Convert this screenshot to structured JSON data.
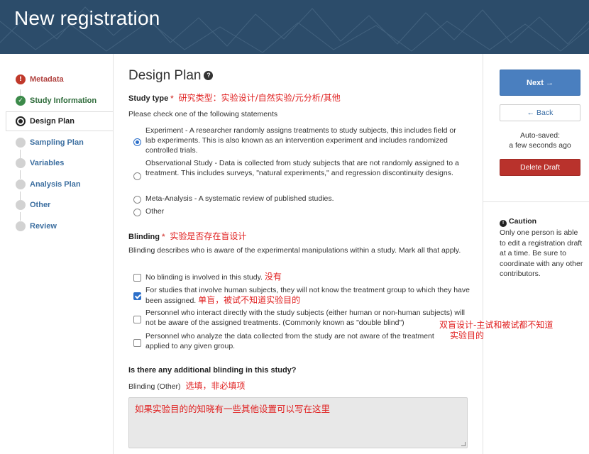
{
  "header": {
    "title": "New registration"
  },
  "nav": [
    {
      "label": "Metadata",
      "status": "error"
    },
    {
      "label": "Study Information",
      "status": "done"
    },
    {
      "label": "Design Plan",
      "status": "current"
    },
    {
      "label": "Sampling Plan",
      "status": "todo"
    },
    {
      "label": "Variables",
      "status": "todo"
    },
    {
      "label": "Analysis Plan",
      "status": "todo"
    },
    {
      "label": "Other",
      "status": "todo"
    },
    {
      "label": "Review",
      "status": "todo"
    }
  ],
  "main": {
    "title": "Design Plan",
    "help_icon": "question-icon",
    "study_type": {
      "label": "Study type",
      "required_mark": "*",
      "annotation": "研究类型：实验设计/自然实验/元分析/其他",
      "instruction": "Please check one of the following statements",
      "options": [
        {
          "text": "Experiment - A researcher randomly assigns treatments to study subjects, this includes field or lab experiments. This is also known as an intervention experiment and includes randomized controlled trials.",
          "checked": true
        },
        {
          "text": "Observational Study - Data is collected from study subjects that are not randomly assigned to a treatment. This includes surveys, \"natural experiments,\" and regression discontinuity designs.",
          "checked": false
        },
        {
          "text": "Meta-Analysis - A systematic review of published studies.",
          "checked": false
        },
        {
          "text": "Other",
          "checked": false
        }
      ]
    },
    "blinding": {
      "label": "Blinding",
      "required_mark": "*",
      "annotation": "实验是否存在盲设计",
      "instruction": "Blinding describes who is aware of the experimental manipulations within a study. Mark all that apply.",
      "options": [
        {
          "text": "No blinding is involved in this study.",
          "checked": false,
          "annotation": "没有"
        },
        {
          "text": "For studies that involve human subjects, they will not know the treatment group to which they have been assigned.",
          "checked": true,
          "annotation": "单盲，被试不知道实验目的"
        },
        {
          "text": "Personnel who interact directly with the study subjects (either human or non-human subjects) will not be aware of the assigned treatments. (Commonly known as \"double blind\")",
          "checked": false,
          "annotation": "双盲设计-主试和被试都不知道"
        },
        {
          "text": "Personnel who analyze the data collected from the study are not aware of the treatment applied to any given group.",
          "checked": false,
          "annotation": "实验目的"
        }
      ]
    },
    "additional_blinding": {
      "question": "Is there any additional blinding in this study?",
      "field_label": "Blinding (Other)",
      "annotation": "选填，非必填项",
      "value": "如果实验目的的知晓有一些其他设置可以写在这里"
    }
  },
  "sidebar": {
    "next_label": "Next →",
    "back_label": "← Back",
    "autosave_line1": "Auto-saved:",
    "autosave_line2": "a few seconds ago",
    "delete_label": "Delete Draft",
    "caution_title": "Caution",
    "caution_body": "Only one person is able to edit a registration draft at a time. Be sure to coordinate with any other contributors."
  }
}
